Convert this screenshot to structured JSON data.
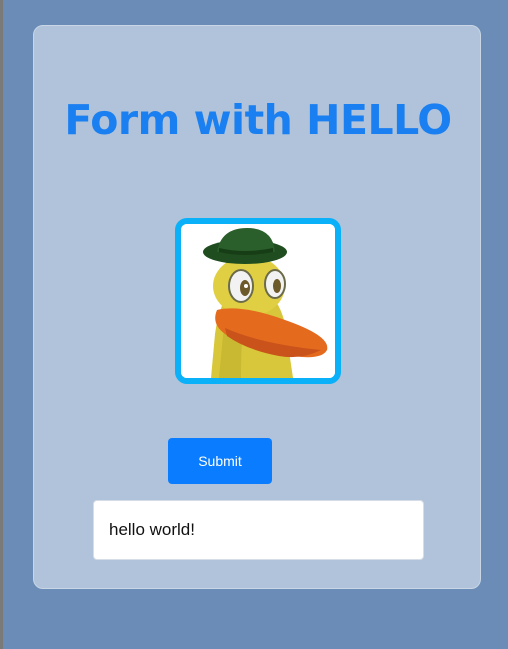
{
  "form": {
    "title": "Form with HELLO",
    "image": {
      "subject": "cartoon yellow duck wearing a green hat",
      "icon": "duck-avatar"
    },
    "submit_label": "Submit",
    "output_text": "hello world!"
  },
  "colors": {
    "page_background": "#6a8cb6",
    "card_background": "#b0c3da",
    "title": "#1a7ff0",
    "image_border": "#0ab0f8",
    "button": "#0a7cff"
  }
}
